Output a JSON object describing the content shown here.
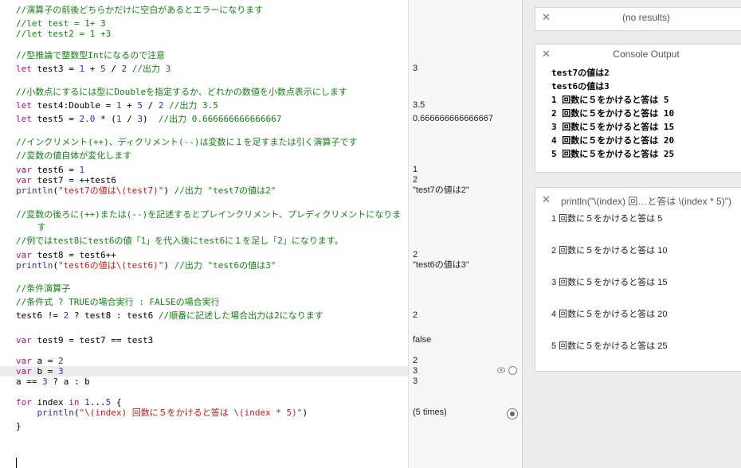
{
  "editor": {
    "lines": [
      "//演算子の前後どちらかだけに空白があるとエラーになります",
      "//let test = 1+ 3",
      "//let test2 = 1 +3",
      "//型推論で整数型Intになるので注意",
      "let test3 = 1 + 5 / 2 //出力 3",
      "//小数点にするには型にDoubleを指定するか、どれかの数値を小数点表示にします",
      "let test4:Double = 1 + 5 / 2 //出力 3.5",
      "let test5 = 2.0 * (1 / 3)  //出力 0.666666666666667",
      "//インクリメント(++)、ディクリメント(--)は変数に１を足すまたは引く演算子です",
      "//変数の値自体が変化します",
      "var test6 = 1",
      "var test7 = ++test6",
      "println(\"test7の値は\\(test7)\") //出力 \"test7の値は2\"",
      "//変数の後ろに(++)または(--)を記述するとプレインクリメント、プレディクリメントになりま",
      "    す",
      "//例ではtest8にtest6の値「1」を代入後にtest6に１を足し「2」になります。",
      "var test8 = test6++",
      "println(\"test6の値は\\(test6)\") //出力 \"test6の値は3\"",
      "//条件演算子",
      "//条件式 ? TRUEの場合実行 : FALSEの場合実行",
      "test6 != 2 ? test8 : test6 //順番に記述した場合出力は2になります",
      "var test9 = test7 == test3",
      "var a = 2",
      "var b = 3",
      "a == 3 ? a : b",
      "for index in 1...5 {",
      "    println(\"\\(index) 回数に５をかけると答は \\(index * 5)\")",
      "}"
    ]
  },
  "results": {
    "test3": "3",
    "test4": "3.5",
    "test5": "0.666666666666667",
    "test6": "1",
    "test7": "2",
    "println1": "\"test7の値は2\"",
    "test8": "2",
    "println2": "\"test6の値は3\"",
    "ternary": "2",
    "test9": "false",
    "a": "2",
    "b": "3",
    "ab": "3",
    "loop": "(5 times)"
  },
  "panels": {
    "no_results": {
      "title": "(no results)"
    },
    "console": {
      "title": "Console Output",
      "lines": [
        "test7の値は2",
        "test6の値は3",
        "1 回数に５をかけると答は 5",
        "2 回数に５をかけると答は 10",
        "3 回数に５をかけると答は 15",
        "4 回数に５をかけると答は 20",
        "5 回数に５をかけると答は 25"
      ]
    },
    "println": {
      "title": "println(\"\\(index) 回…と答は \\(index * 5)\")",
      "lines": [
        "1 回数に５をかけると答は 5",
        "2 回数に５をかけると答は 10",
        "3 回数に５をかけると答は 15",
        "4 回数に５をかけると答は 20",
        "5 回数に５をかけると答は 25"
      ]
    }
  },
  "icons": {
    "close": "close-icon",
    "eye": "quick-look-eye-icon",
    "value": "value-history-icon",
    "record": "record-icon"
  }
}
